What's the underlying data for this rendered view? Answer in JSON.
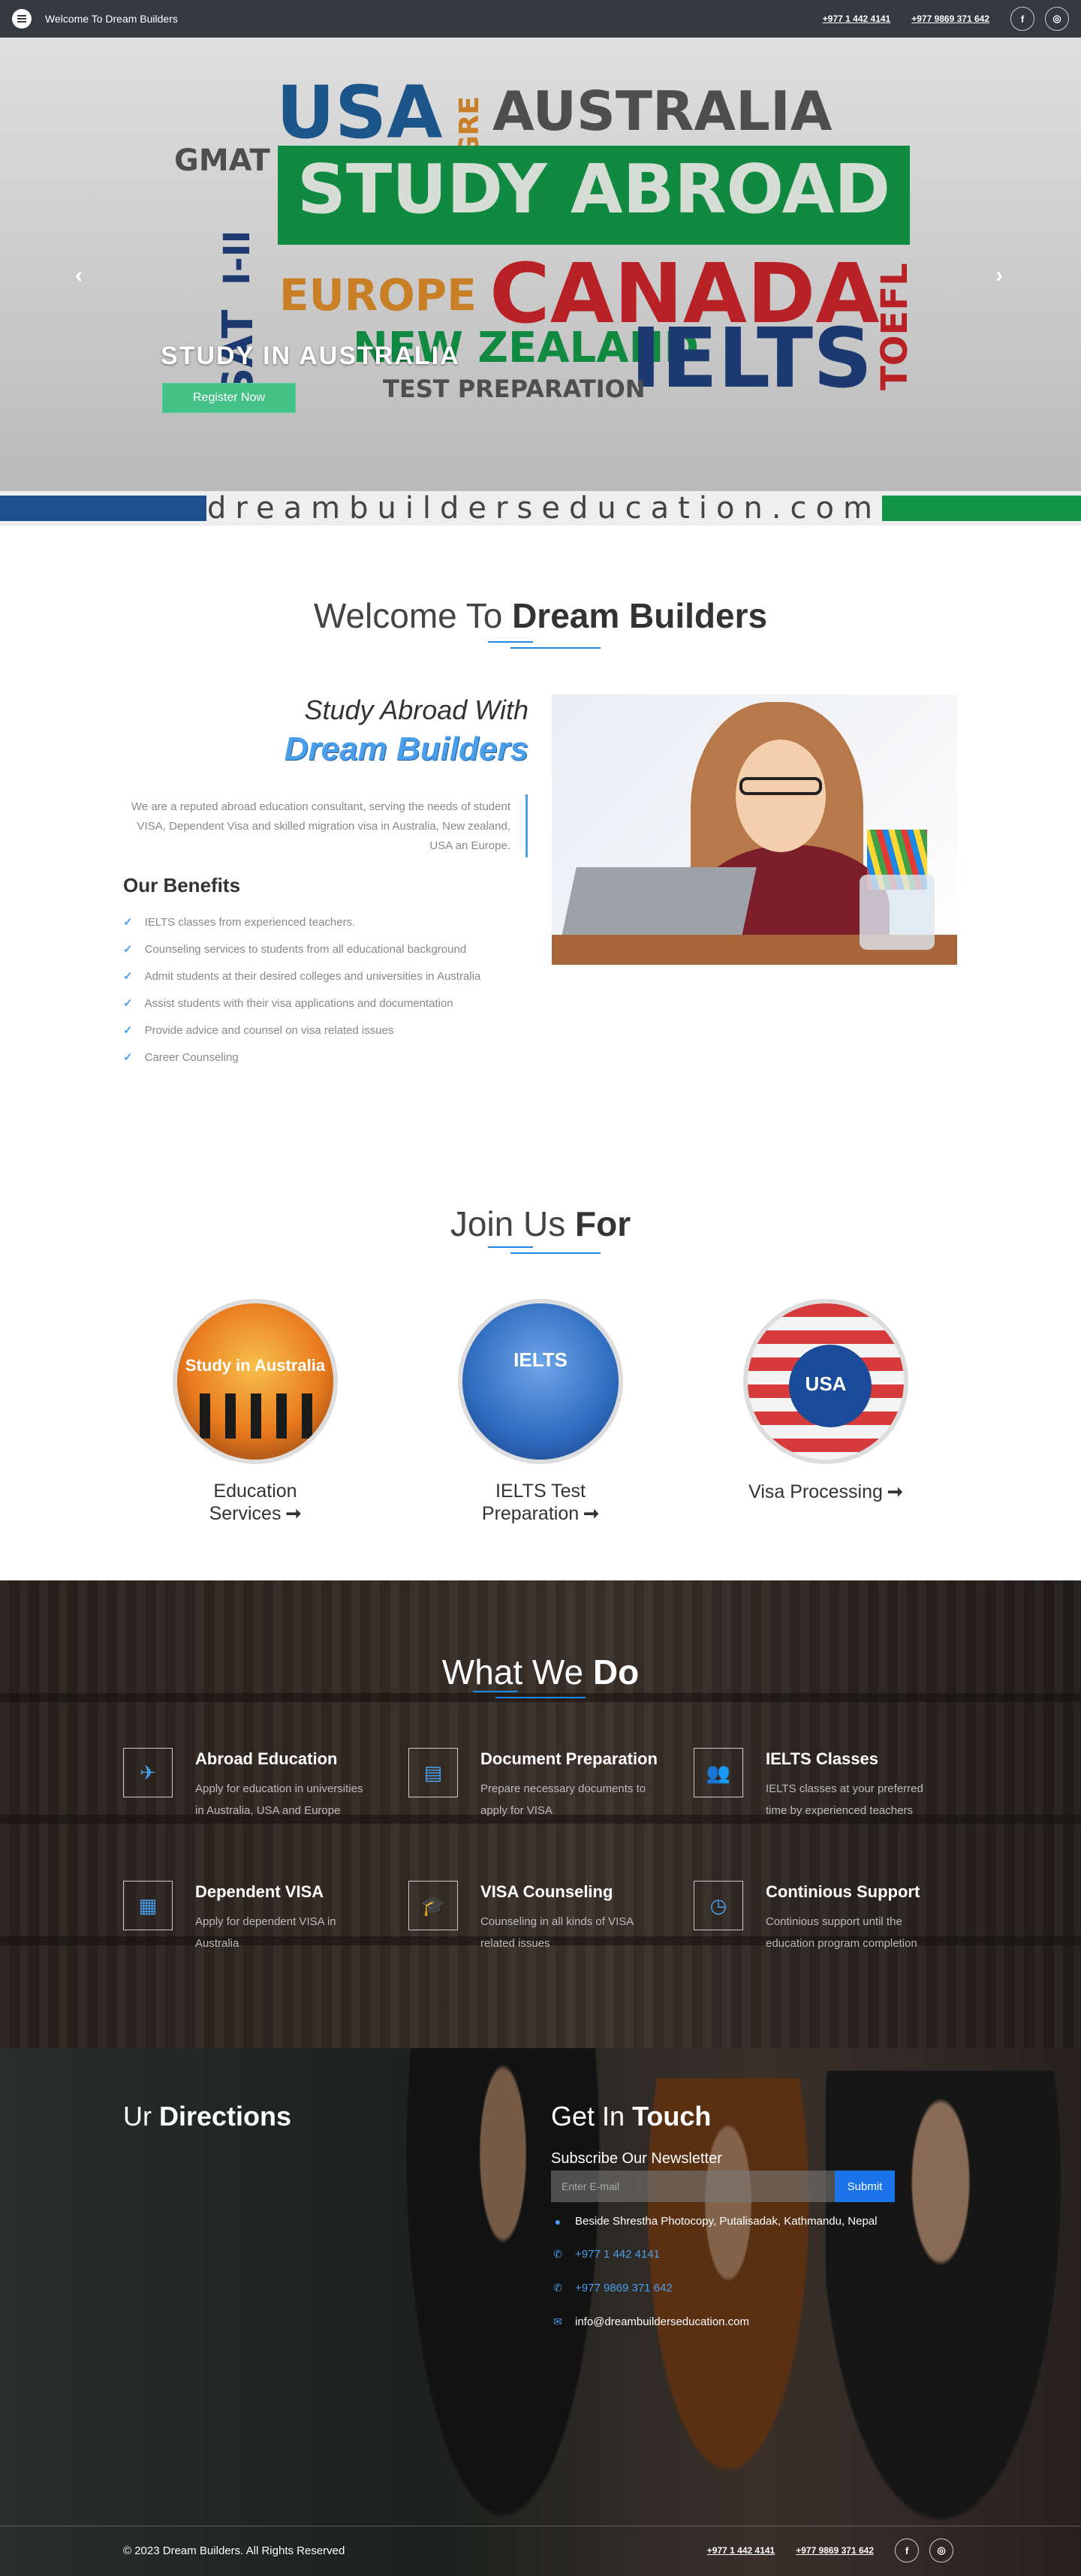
{
  "topbar": {
    "welcome": "Welcome To Dream Builders",
    "phone1": "+977 1 442 4141",
    "phone2": "+977 9869 371 642",
    "facebook": "f",
    "instagram": "◎"
  },
  "hero": {
    "words": {
      "usa": "USA",
      "gre": "GRE",
      "australia": "AUSTRALIA",
      "gmat": "GMAT",
      "study_abroad": "STUDY ABROAD",
      "ielts_vertical": "I-II",
      "sat": "SAT",
      "europe": "EUROPE",
      "canada": "CANADA",
      "toefl": "TOEFL",
      "new_zealand": "NEW ZEALAND",
      "ielts": "IELTS",
      "test_prep": "TEST PREPARATION"
    },
    "domain": "dreambuilderseducation.com",
    "caption": "STUDY IN AUSTRALIA",
    "register": "Register Now",
    "prev": "‹",
    "next": "›"
  },
  "welcome": {
    "title_light": "Welcome To ",
    "title_bold": "Dream Builders",
    "study_line1": "Study Abroad With",
    "study_line2": "Dream Builders",
    "about": "We are a reputed abroad education consultant, serving the needs of student VISA, Dependent Visa and skilled migration visa in Australia, New zealand, USA an Europe.",
    "benefits_title": "Our Benefits",
    "benefits": [
      "IELTS classes from experienced teachers.",
      "Counseling services to students from all educational background",
      "Admit students at their desired colleges and universities in Australia",
      "Assist students with their visa applications and documentation",
      "Provide advice and counsel on visa related issues",
      "Career Counseling"
    ]
  },
  "join": {
    "title_light": "Join Us ",
    "title_bold": "For",
    "cards": [
      {
        "label": "Education Services",
        "tag": "Study in Australia"
      },
      {
        "label": "IELTS Test Preparation",
        "tag": "IELTS"
      },
      {
        "label": "Visa Processing",
        "tag": "USA"
      }
    ],
    "arrow": "➞"
  },
  "what_we_do": {
    "title_light": "What We ",
    "title_bold": "Do",
    "services": [
      {
        "title": "Abroad Education",
        "desc": "Apply for education in universities in Australia, USA and Europe",
        "icon": "✈"
      },
      {
        "title": "Document Preparation",
        "desc": "Prepare necessary documents to apply for VISA",
        "icon": "▤"
      },
      {
        "title": "IELTS Classes",
        "desc": "IELTS classes at your preferred time by experienced teachers",
        "icon": "👥"
      },
      {
        "title": "Dependent VISA",
        "desc": "Apply for dependent VISA in Australia",
        "icon": "▦"
      },
      {
        "title": "VISA Counseling",
        "desc": "Counseling in all kinds of VISA related issues",
        "icon": "🎓"
      },
      {
        "title": "Continious Support",
        "desc": "Continious support until the education program completion",
        "icon": "◷"
      }
    ]
  },
  "contact": {
    "dir_light": "Ur ",
    "dir_bold": "Directions",
    "touch_light": "Get In ",
    "touch_bold": "Touch",
    "newsletter_label": "Subscribe Our Newsletter",
    "newsletter_placeholder": "Enter E-mail",
    "submit": "Submit",
    "address": "Beside Shrestha Photocopy, Putalisadak, Kathmandu, Nepal",
    "phone1": "+977 1 442 4141",
    "phone2": "+977 9869 371 642",
    "email": "info@dreambuilderseducation.com"
  },
  "footer": {
    "copyright": "© 2023 Dream Builders. All Rights Reserved",
    "phone1": "+977 1 442 4141",
    "phone2": "+977 9869 371 642",
    "facebook": "f",
    "instagram": "◎"
  },
  "colors": {
    "accent": "#4a9eea",
    "topbar": "#343a40",
    "register": "#43c187",
    "submit": "#1a73e8"
  }
}
